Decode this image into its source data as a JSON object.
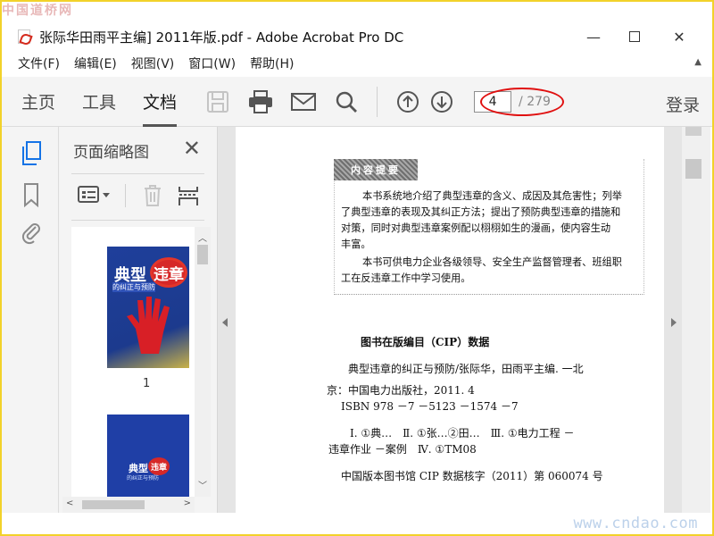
{
  "watermark": {
    "top": "中国道桥网",
    "bottom": "www.cndao.com"
  },
  "window": {
    "title": "张际华田雨平主编] 2011年版.pdf - Adobe Acrobat Pro DC",
    "minimize_label": "—",
    "close_label": "✕"
  },
  "menu": {
    "items": [
      "文件(F)",
      "编辑(E)",
      "视图(V)",
      "窗口(W)",
      "帮助(H)"
    ],
    "collapse_label": "▲"
  },
  "toolbar": {
    "tabs": [
      "主页",
      "工具",
      "文档"
    ],
    "active_tab": "文档",
    "current_page": "4",
    "total_pages": "/ 279",
    "login_label": "登录"
  },
  "panel": {
    "title": "页面缩略图",
    "close_label": "✕",
    "thumbnails": [
      {
        "page_label": "1",
        "cover_title": "典型",
        "cover_badge": "违章",
        "cover_subtitle": "的纠正与预防"
      },
      {
        "page_label": "",
        "cover_title": "典型",
        "cover_badge": "违章",
        "cover_subtitle": "的纠正与预防"
      }
    ]
  },
  "document": {
    "abstract_label": "内容提要",
    "abstract_lines": [
      "本书系统地介绍了典型违章的含义、成因及其危害性；列举",
      "了典型违章的表现及其纠正方法；提出了预防典型违章的措施和",
      "对策，同时对典型违章案例配以栩栩如生的漫画，使内容生动",
      "丰富。",
      "本书可供电力企业各级领导、安全生产监督管理者、班组职",
      "工在反违章工作中学习使用。"
    ],
    "cip_title": "图书在版编目（CIP）数据",
    "cip_lines": [
      "典型违章的纠正与预防/张际华，田雨平主编. 一北",
      "京：中国电力出版社，2011. 4",
      "ISBN 978 －7 －5123 －1574 －7",
      "Ⅰ. ①典…　Ⅱ. ①张…②田…　Ⅲ. ①电力工程 －",
      "违章作业 －案例　Ⅳ. ①TM08",
      "中国版本图书馆 CIP 数据核字（2011）第 060074 号"
    ]
  },
  "colors": {
    "accent_oval": "#e01010",
    "toolbar_bg": "#f4f4f4",
    "doc_bg": "#e5e5e5",
    "frame": "#f2d22a"
  }
}
